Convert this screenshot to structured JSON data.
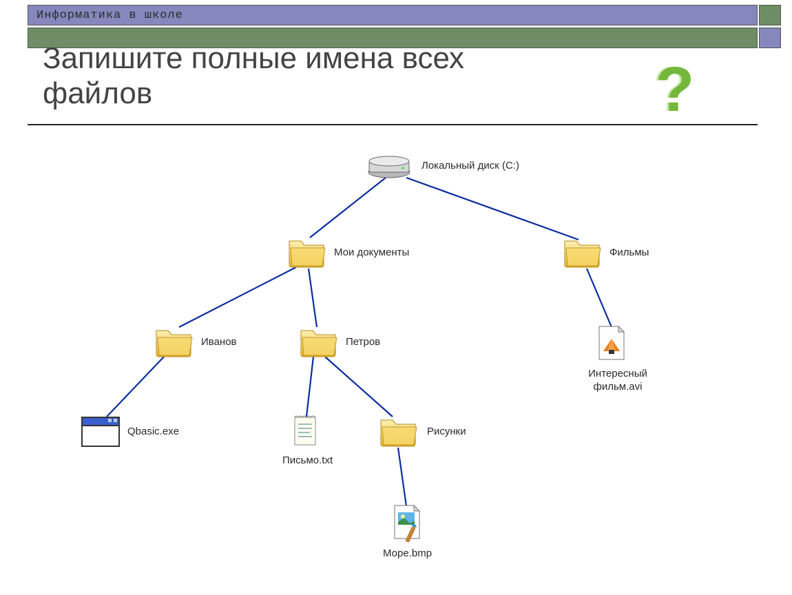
{
  "header": {
    "banner_text": "Информатика в школе"
  },
  "title": "Запишите полные имена всех\nфайлов",
  "question_mark": "?",
  "tree": {
    "root": {
      "label": "Локальный диск (C:)",
      "icon": "disk"
    },
    "nodes": [
      {
        "id": "docs",
        "label": "Мои документы",
        "icon": "folder"
      },
      {
        "id": "films",
        "label": "Фильмы",
        "icon": "folder"
      },
      {
        "id": "ivanov",
        "label": "Иванов",
        "icon": "folder"
      },
      {
        "id": "petrov",
        "label": "Петров",
        "icon": "folder"
      },
      {
        "id": "qbasic",
        "label": "Qbasic.exe",
        "icon": "exe"
      },
      {
        "id": "letter",
        "label": "Письмо.txt",
        "icon": "txt"
      },
      {
        "id": "pics",
        "label": "Рисунки",
        "icon": "folder"
      },
      {
        "id": "sea",
        "label": "Море.bmp",
        "icon": "bmp"
      },
      {
        "id": "movie",
        "label": "Интересный фильм.avi",
        "icon": "avi"
      }
    ]
  }
}
